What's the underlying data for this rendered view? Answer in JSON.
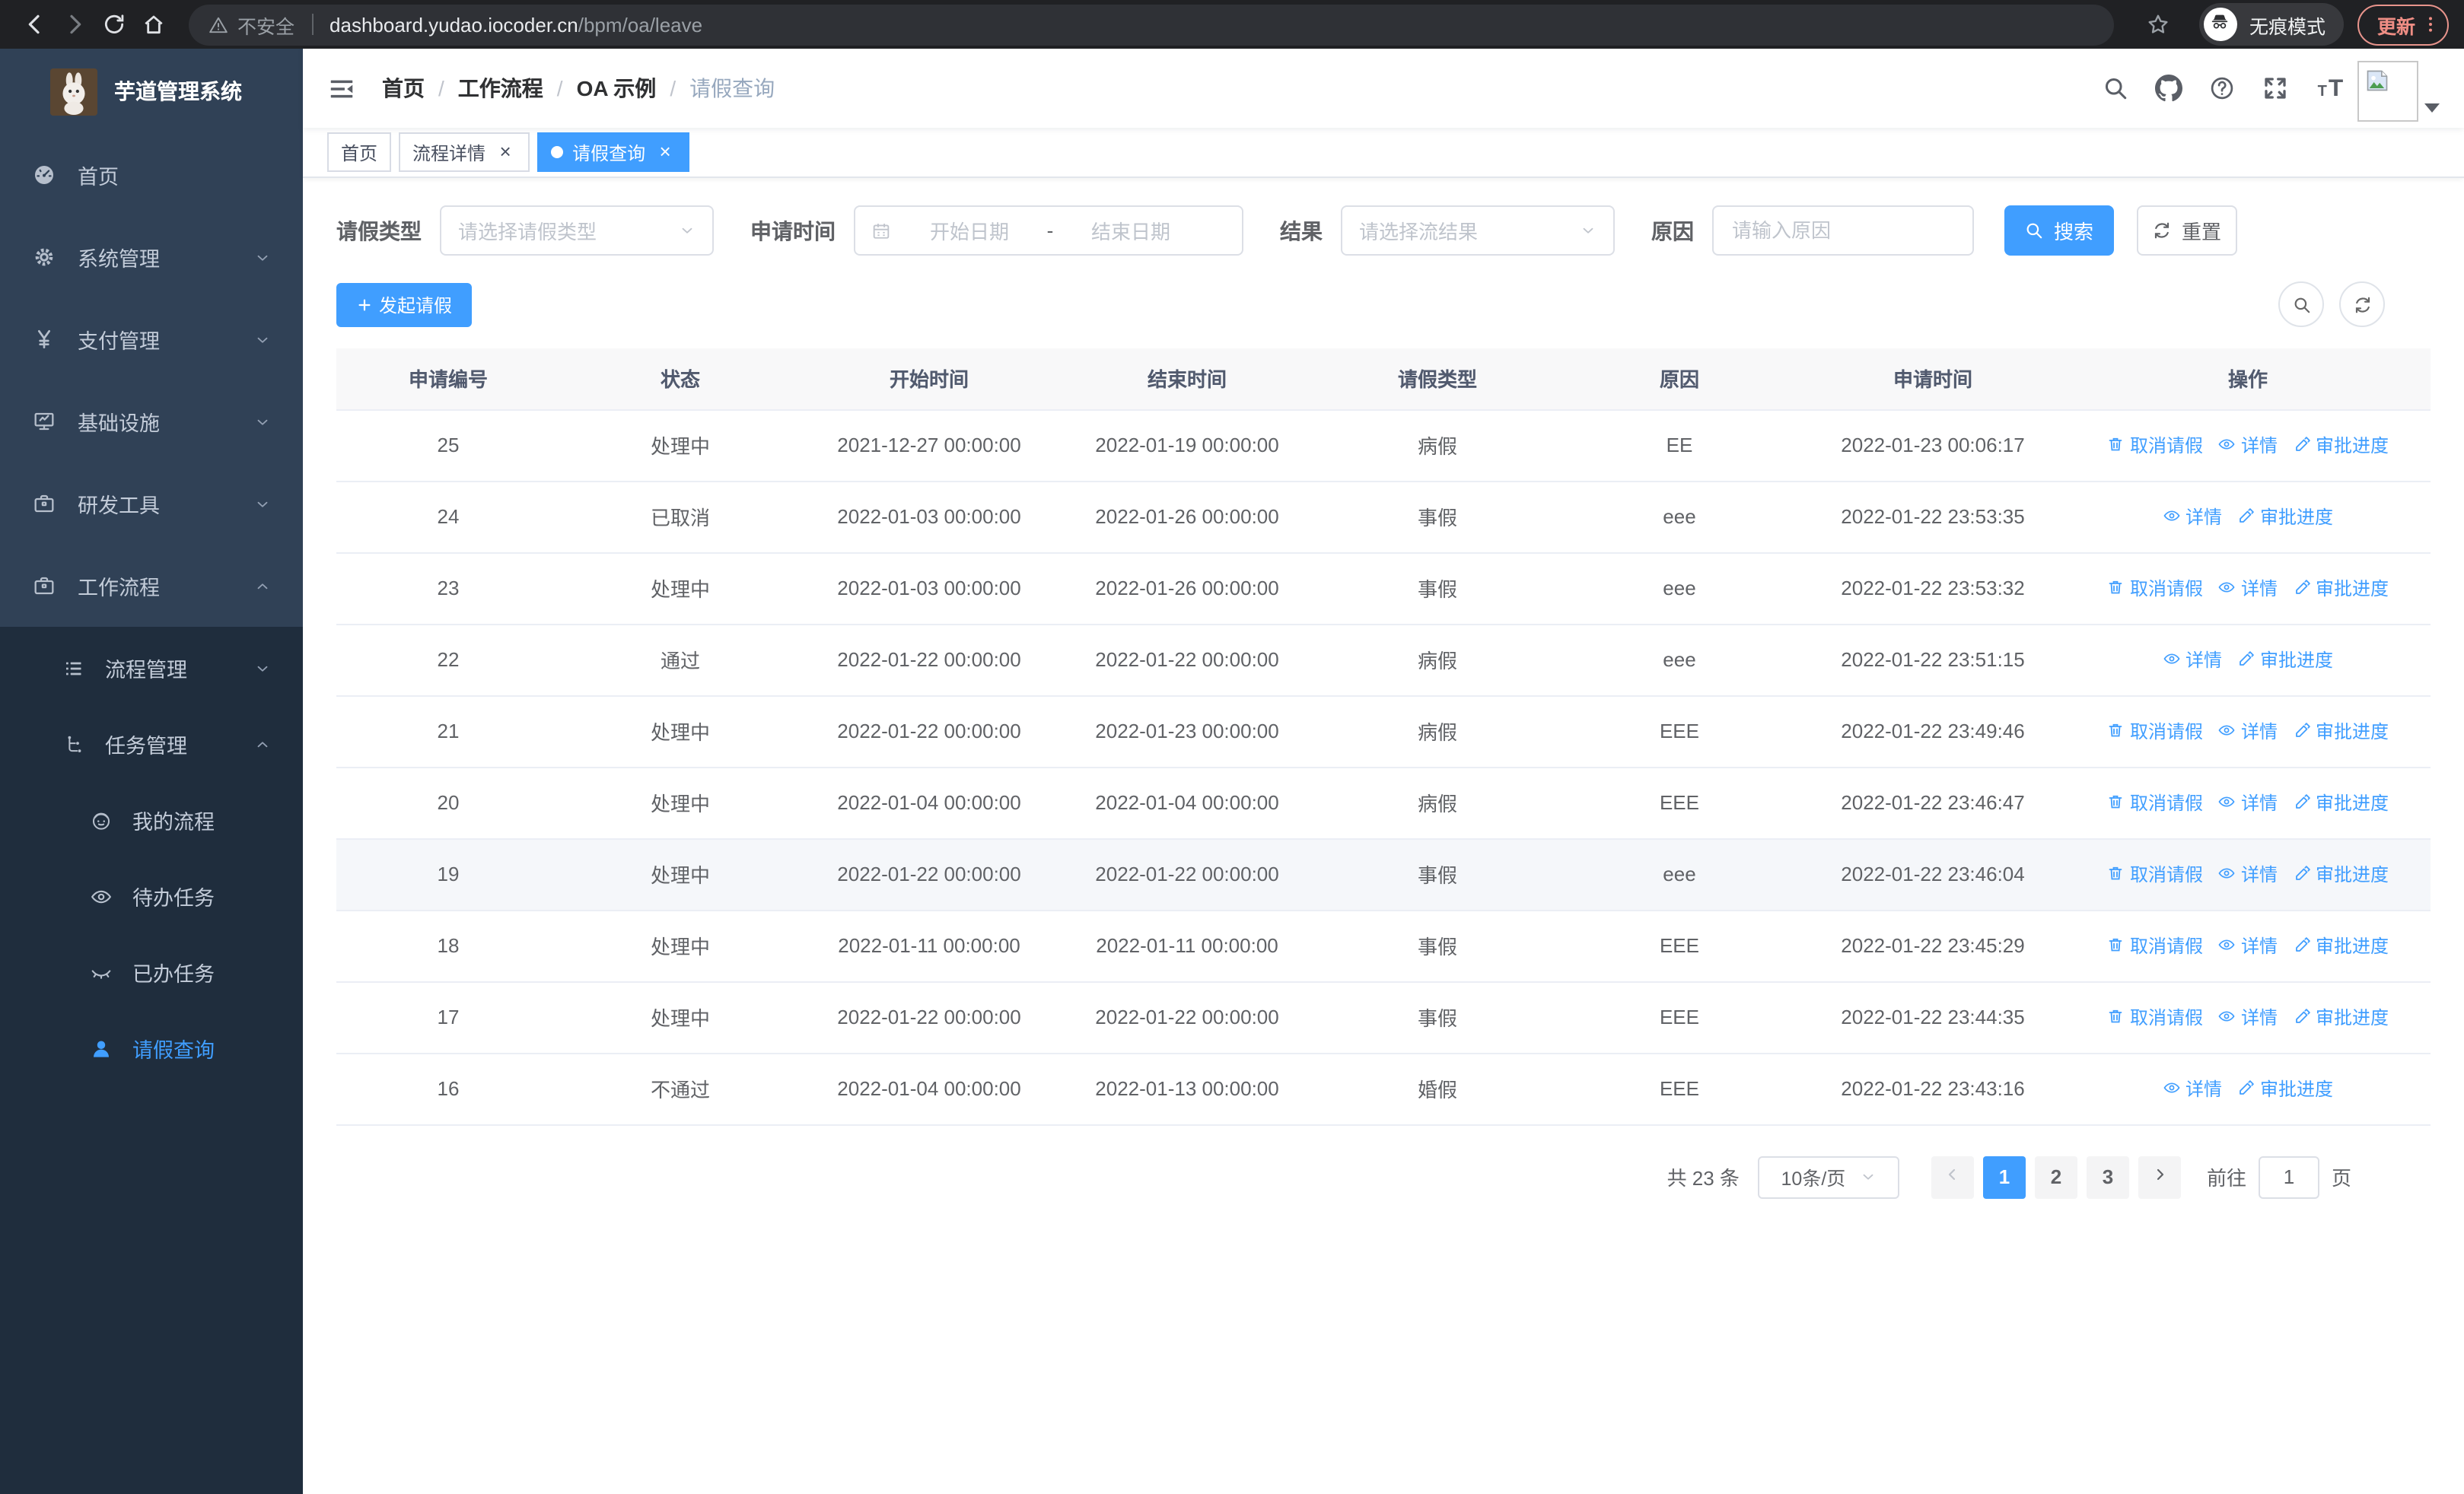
{
  "browser": {
    "security_label": "不安全",
    "url_host": "dashboard.yudao.iocoder.cn",
    "url_path": "/bpm/oa/leave",
    "incognito_label": "无痕模式",
    "update_label": "更新"
  },
  "colors": {
    "primary": "#409EFF",
    "sidebar_bg": "#304156",
    "submenu_bg": "#1f2d3d",
    "update_accent": "#ee8d84",
    "link_blue": "#409EFF"
  },
  "sidebar": {
    "title": "芋道管理系统",
    "logo_icon": "rabbit-logo",
    "items": [
      {
        "key": "home",
        "label": "首页",
        "icon": "gauge"
      },
      {
        "key": "system",
        "label": "系统管理",
        "icon": "gear",
        "arrow": "down"
      },
      {
        "key": "payment",
        "label": "支付管理",
        "icon": "yen",
        "arrow": "down"
      },
      {
        "key": "infra",
        "label": "基础设施",
        "icon": "monitor",
        "arrow": "down"
      },
      {
        "key": "dev-tools",
        "label": "研发工具",
        "icon": "briefcase",
        "arrow": "down"
      },
      {
        "key": "workflow",
        "label": "工作流程",
        "icon": "briefcase",
        "arrow": "up"
      }
    ],
    "submenu": [
      {
        "key": "process-mgmt",
        "label": "流程管理",
        "icon": "list",
        "level": 2,
        "arrow": "down"
      },
      {
        "key": "task-mgmt",
        "label": "任务管理",
        "icon": "tree",
        "level": 2,
        "arrow": "up"
      },
      {
        "key": "my-process",
        "label": "我的流程",
        "icon": "face",
        "level": 3
      },
      {
        "key": "todo-tasks",
        "label": "待办任务",
        "icon": "eye-open",
        "level": 3
      },
      {
        "key": "done-tasks",
        "label": "已办任务",
        "icon": "eye-closed",
        "level": 3
      },
      {
        "key": "leave-query",
        "label": "请假查询",
        "icon": "user",
        "level": 3,
        "active": true
      }
    ]
  },
  "header": {
    "breadcrumb": [
      "首页",
      "工作流程",
      "OA 示例",
      "请假查询"
    ],
    "icons": [
      "search",
      "github",
      "question",
      "fullscreen",
      "font-size"
    ]
  },
  "tabs": [
    {
      "key": "home",
      "label": "首页",
      "closable": false,
      "active": false
    },
    {
      "key": "process-detail",
      "label": "流程详情",
      "closable": true,
      "active": false
    },
    {
      "key": "leave-query",
      "label": "请假查询",
      "closable": true,
      "active": true
    }
  ],
  "filters": {
    "leave_type_label": "请假类型",
    "leave_type_placeholder": "请选择请假类型",
    "apply_time_label": "申请时间",
    "start_date_placeholder": "开始日期",
    "range_separator": "-",
    "end_date_placeholder": "结束日期",
    "result_label": "结果",
    "result_placeholder": "请选择流结果",
    "reason_label": "原因",
    "reason_placeholder": "请输入原因",
    "search_label": "搜索",
    "reset_label": "重置"
  },
  "toolbar": {
    "create_label": "发起请假"
  },
  "table": {
    "columns": [
      "申请编号",
      "状态",
      "开始时间",
      "结束时间",
      "请假类型",
      "原因",
      "申请时间",
      "操作"
    ],
    "action_labels": {
      "cancel": "取消请假",
      "detail": "详情",
      "progress": "审批进度"
    },
    "rows": [
      {
        "id": "25",
        "status": "处理中",
        "start": "2021-12-27 00:00:00",
        "end": "2022-01-19 00:00:00",
        "type": "病假",
        "reason": "EE",
        "applied": "2022-01-23 00:06:17",
        "cancelable": true,
        "hover": false
      },
      {
        "id": "24",
        "status": "已取消",
        "start": "2022-01-03 00:00:00",
        "end": "2022-01-26 00:00:00",
        "type": "事假",
        "reason": "eee",
        "applied": "2022-01-22 23:53:35",
        "cancelable": false,
        "hover": false
      },
      {
        "id": "23",
        "status": "处理中",
        "start": "2022-01-03 00:00:00",
        "end": "2022-01-26 00:00:00",
        "type": "事假",
        "reason": "eee",
        "applied": "2022-01-22 23:53:32",
        "cancelable": true,
        "hover": false
      },
      {
        "id": "22",
        "status": "通过",
        "start": "2022-01-22 00:00:00",
        "end": "2022-01-22 00:00:00",
        "type": "病假",
        "reason": "eee",
        "applied": "2022-01-22 23:51:15",
        "cancelable": false,
        "hover": false
      },
      {
        "id": "21",
        "status": "处理中",
        "start": "2022-01-22 00:00:00",
        "end": "2022-01-23 00:00:00",
        "type": "病假",
        "reason": "EEE",
        "applied": "2022-01-22 23:49:46",
        "cancelable": true,
        "hover": false
      },
      {
        "id": "20",
        "status": "处理中",
        "start": "2022-01-04 00:00:00",
        "end": "2022-01-04 00:00:00",
        "type": "病假",
        "reason": "EEE",
        "applied": "2022-01-22 23:46:47",
        "cancelable": true,
        "hover": false
      },
      {
        "id": "19",
        "status": "处理中",
        "start": "2022-01-22 00:00:00",
        "end": "2022-01-22 00:00:00",
        "type": "事假",
        "reason": "eee",
        "applied": "2022-01-22 23:46:04",
        "cancelable": true,
        "hover": true
      },
      {
        "id": "18",
        "status": "处理中",
        "start": "2022-01-11 00:00:00",
        "end": "2022-01-11 00:00:00",
        "type": "事假",
        "reason": "EEE",
        "applied": "2022-01-22 23:45:29",
        "cancelable": true,
        "hover": false
      },
      {
        "id": "17",
        "status": "处理中",
        "start": "2022-01-22 00:00:00",
        "end": "2022-01-22 00:00:00",
        "type": "事假",
        "reason": "EEE",
        "applied": "2022-01-22 23:44:35",
        "cancelable": true,
        "hover": false
      },
      {
        "id": "16",
        "status": "不通过",
        "start": "2022-01-04 00:00:00",
        "end": "2022-01-13 00:00:00",
        "type": "婚假",
        "reason": "EEE",
        "applied": "2022-01-22 23:43:16",
        "cancelable": false,
        "hover": false
      }
    ]
  },
  "pagination": {
    "total_label": "共 23 条",
    "page_size": "10条/页",
    "pages": [
      "1",
      "2",
      "3"
    ],
    "active_page": "1",
    "goto_label": "前往",
    "goto_value": "1",
    "goto_suffix": "页"
  }
}
